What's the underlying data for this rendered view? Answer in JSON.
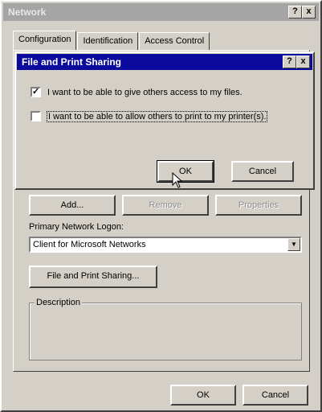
{
  "window": {
    "title": "Network",
    "help_btn": "?",
    "close_btn": "x"
  },
  "tabs": [
    {
      "label": "Configuration"
    },
    {
      "label": "Identification"
    },
    {
      "label": "Access Control"
    }
  ],
  "component_buttons": {
    "add": "Add...",
    "remove": "Remove",
    "properties": "Properties"
  },
  "primary_logon": {
    "label": "Primary Network Logon:",
    "value": "Client for Microsoft Networks"
  },
  "file_print_button": "File and Print Sharing...",
  "description_group": "Description",
  "footer": {
    "ok": "OK",
    "cancel": "Cancel"
  },
  "dialog": {
    "title": "File and Print Sharing",
    "help_btn": "?",
    "close_btn": "x",
    "files_option": {
      "label": "I want to be able to give others access to my files.",
      "checked": true
    },
    "printers_option": {
      "label": "I want to be able to allow others to print to my printer(s).",
      "checked": false
    },
    "ok": "OK",
    "cancel": "Cancel"
  }
}
